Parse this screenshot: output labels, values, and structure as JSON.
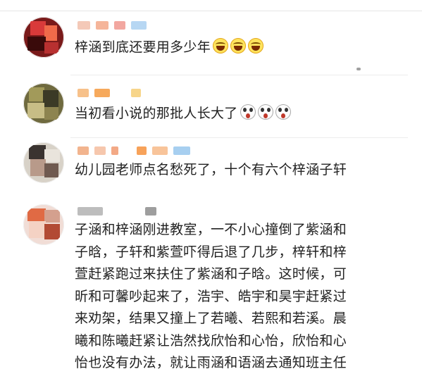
{
  "comments": [
    {
      "text": "梓涵到底还要用多少年",
      "emoji": "laughing-crying-emoji",
      "emoji_count": 3
    },
    {
      "text": "当初看小说的那批人长大了",
      "emoji": "shocked-face-emoji",
      "emoji_count": 3
    },
    {
      "text": "幼儿园老师点名愁死了，十个有六个梓涵子轩"
    },
    {
      "lines": [
        "子涵和梓涵刚进教室，一不小心撞倒了紫涵和",
        "子晗，子轩和紫萱吓得后退了几步，梓轩和梓",
        "萱赶紧跑过来扶住了紫涵和子晗。这时候，可",
        "昕和可馨吵起来了，浩宇、皓宇和昊宇赶紧过",
        "来劝架，结果又撞上了若曦、若熙和若溪。晨",
        "曦和陈曦赶紧让浩然找欣怡和心怡，欣怡和心",
        "怡也没有办法，就让雨涵和语涵去通知班主任"
      ]
    }
  ],
  "colors": {
    "background": "#ffffff",
    "text": "#222222",
    "separator": "#ececec"
  }
}
